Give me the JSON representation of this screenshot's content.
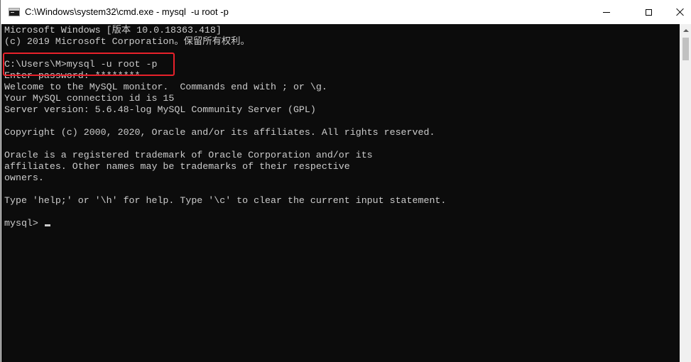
{
  "window": {
    "title": "C:\\Windows\\system32\\cmd.exe - mysql  -u root -p",
    "icon": "cmd-icon",
    "controls": {
      "minimize_icon": "minimize-icon",
      "maximize_icon": "maximize-icon",
      "close_icon": "close-icon"
    }
  },
  "console": {
    "colors": {
      "background": "#0c0c0c",
      "text": "#cccccc",
      "highlight": "#e8212b"
    },
    "lines": [
      "Microsoft Windows [版本 10.0.18363.418]",
      "(c) 2019 Microsoft Corporation。保留所有权利。",
      "",
      "C:\\Users\\M>mysql -u root -p",
      "Enter password: ********",
      "Welcome to the MySQL monitor.  Commands end with ; or \\g.",
      "Your MySQL connection id is 15",
      "Server version: 5.6.48-log MySQL Community Server (GPL)",
      "",
      "Copyright (c) 2000, 2020, Oracle and/or its affiliates. All rights reserved.",
      "",
      "Oracle is a registered trademark of Oracle Corporation and/or its",
      "affiliates. Other names may be trademarks of their respective",
      "owners.",
      "",
      "Type 'help;' or '\\h' for help. Type '\\c' to clear the current input statement.",
      "",
      "mysql> "
    ]
  }
}
